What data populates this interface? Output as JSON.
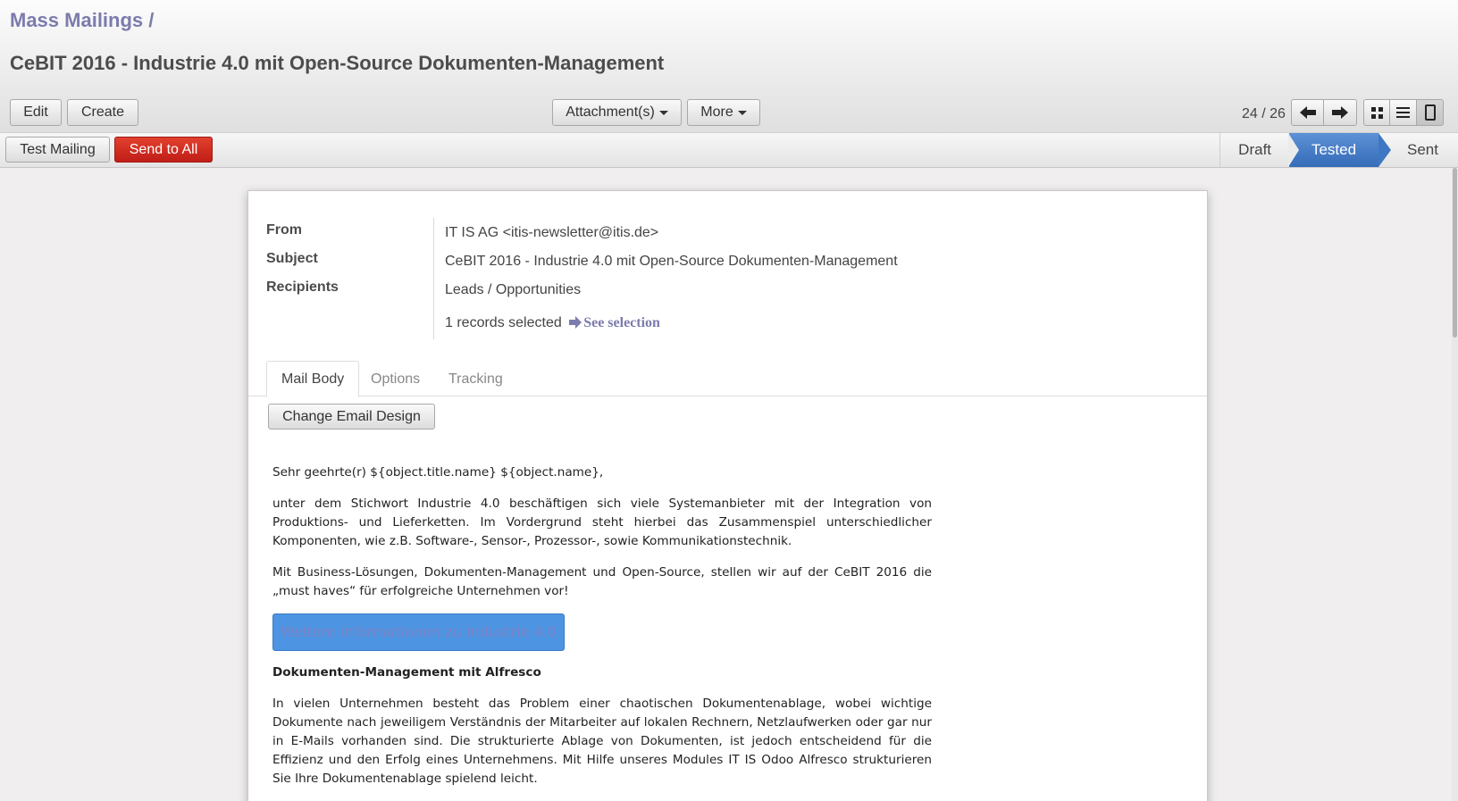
{
  "breadcrumb": {
    "parent": "Mass Mailings",
    "separator": "/"
  },
  "title": "CeBIT 2016 - Industrie 4.0 mit Open-Source Dokumenten-Management",
  "toolbar": {
    "edit_label": "Edit",
    "create_label": "Create",
    "attachments_label": "Attachment(s)",
    "more_label": "More"
  },
  "pager": {
    "value": "24 / 26"
  },
  "views": [
    "kanban",
    "list",
    "form"
  ],
  "statusbar": {
    "test_mailing_label": "Test Mailing",
    "send_all_label": "Send to All",
    "stages": [
      "Draft",
      "Tested",
      "Sent"
    ],
    "current_stage": "Tested"
  },
  "form": {
    "from_label": "From",
    "from_value": "IT IS AG <itis-newsletter@itis.de>",
    "subject_label": "Subject",
    "subject_value": "CeBIT 2016 - Industrie 4.0 mit Open-Source Dokumenten-Management",
    "recipients_label": "Recipients",
    "recipients_value": "Leads / Opportunities",
    "records_selected": "1 records selected",
    "see_selection": "See selection"
  },
  "tabs": [
    "Mail Body",
    "Options",
    "Tracking"
  ],
  "active_tab": "Mail Body",
  "mail_body": {
    "change_design_label": "Change Email Design",
    "greeting": "Sehr geehrte(r) ${object.title.name} ${object.name},",
    "paragraph1": "unter dem Stichwort Industrie 4.0 beschäftigen sich viele Systemanbieter mit der Integration von Produktions- und Lieferketten. Im Vordergrund steht hierbei das Zusammenspiel unterschiedlicher Komponenten, wie z.B. Software-, Sensor-, Prozessor-, sowie Kommunikationstechnik.",
    "paragraph2": "Mit Business-Lösungen, Dokumenten-Management und Open-Source, stellen wir auf der CeBIT 2016 die „must haves“ für erfolgreiche Unternehmen vor!",
    "cta_label": "Weitere Informationen zu Industrie 4.0",
    "heading": "Dokumenten-Management mit Alfresco",
    "paragraph3": "In vielen Unternehmen besteht das Problem einer chaotischen Dokumentenablage, wobei wichtige Dokumente nach jeweiligem Verständnis der Mitarbeiter auf lokalen Rechnern, Netzlaufwerken oder gar nur in E-Mails vorhanden sind. Die strukturierte Ablage von Dokumenten, ist jedoch entscheidend für die Effizienz und den Erfolg eines Unternehmens. Mit Hilfe unseres Modules IT IS Odoo Alfresco strukturieren Sie Ihre Dokumentenablage spielend leicht."
  },
  "colors": {
    "brand": "#7c7bad",
    "danger": "#c01d17",
    "stage_active": "#3f78c2",
    "cta": "#4d94e2"
  }
}
